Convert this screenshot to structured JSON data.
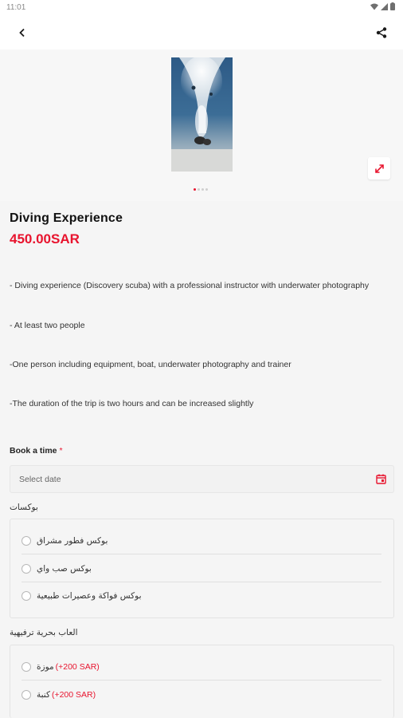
{
  "status_bar": {
    "time": "11:01"
  },
  "gallery": {
    "image_count": 4,
    "active_index": 0
  },
  "product": {
    "title": "Diving Experience",
    "price": "450.00SAR",
    "description": [
      "- Diving experience (Discovery scuba) with a professional instructor with underwater photography",
      "- At least two people",
      "-One person including equipment, boat, underwater photography and trainer",
      "-The duration of the trip is two hours and can be increased slightly"
    ]
  },
  "booking": {
    "label": "Book a time",
    "required_mark": "*",
    "date_placeholder": "Select date"
  },
  "boxes_section": {
    "label": "بوكسات",
    "options": [
      {
        "label": "بوكس فطور مشراق"
      },
      {
        "label": "بوكس صب واي"
      },
      {
        "label": "بوكس فواكة  وعصيرات طبيعية"
      }
    ]
  },
  "games_section": {
    "label": "العاب بحرية ترفيهية",
    "options": [
      {
        "label": "موزة",
        "extra": "(+200 SAR)"
      },
      {
        "label": "كنبة",
        "extra": "(+200 SAR)"
      }
    ]
  },
  "colors": {
    "accent": "#e8142e"
  },
  "icons": {
    "back": "back-arrow-icon",
    "share": "share-icon",
    "expand": "expand-icon",
    "calendar": "calendar-icon"
  }
}
